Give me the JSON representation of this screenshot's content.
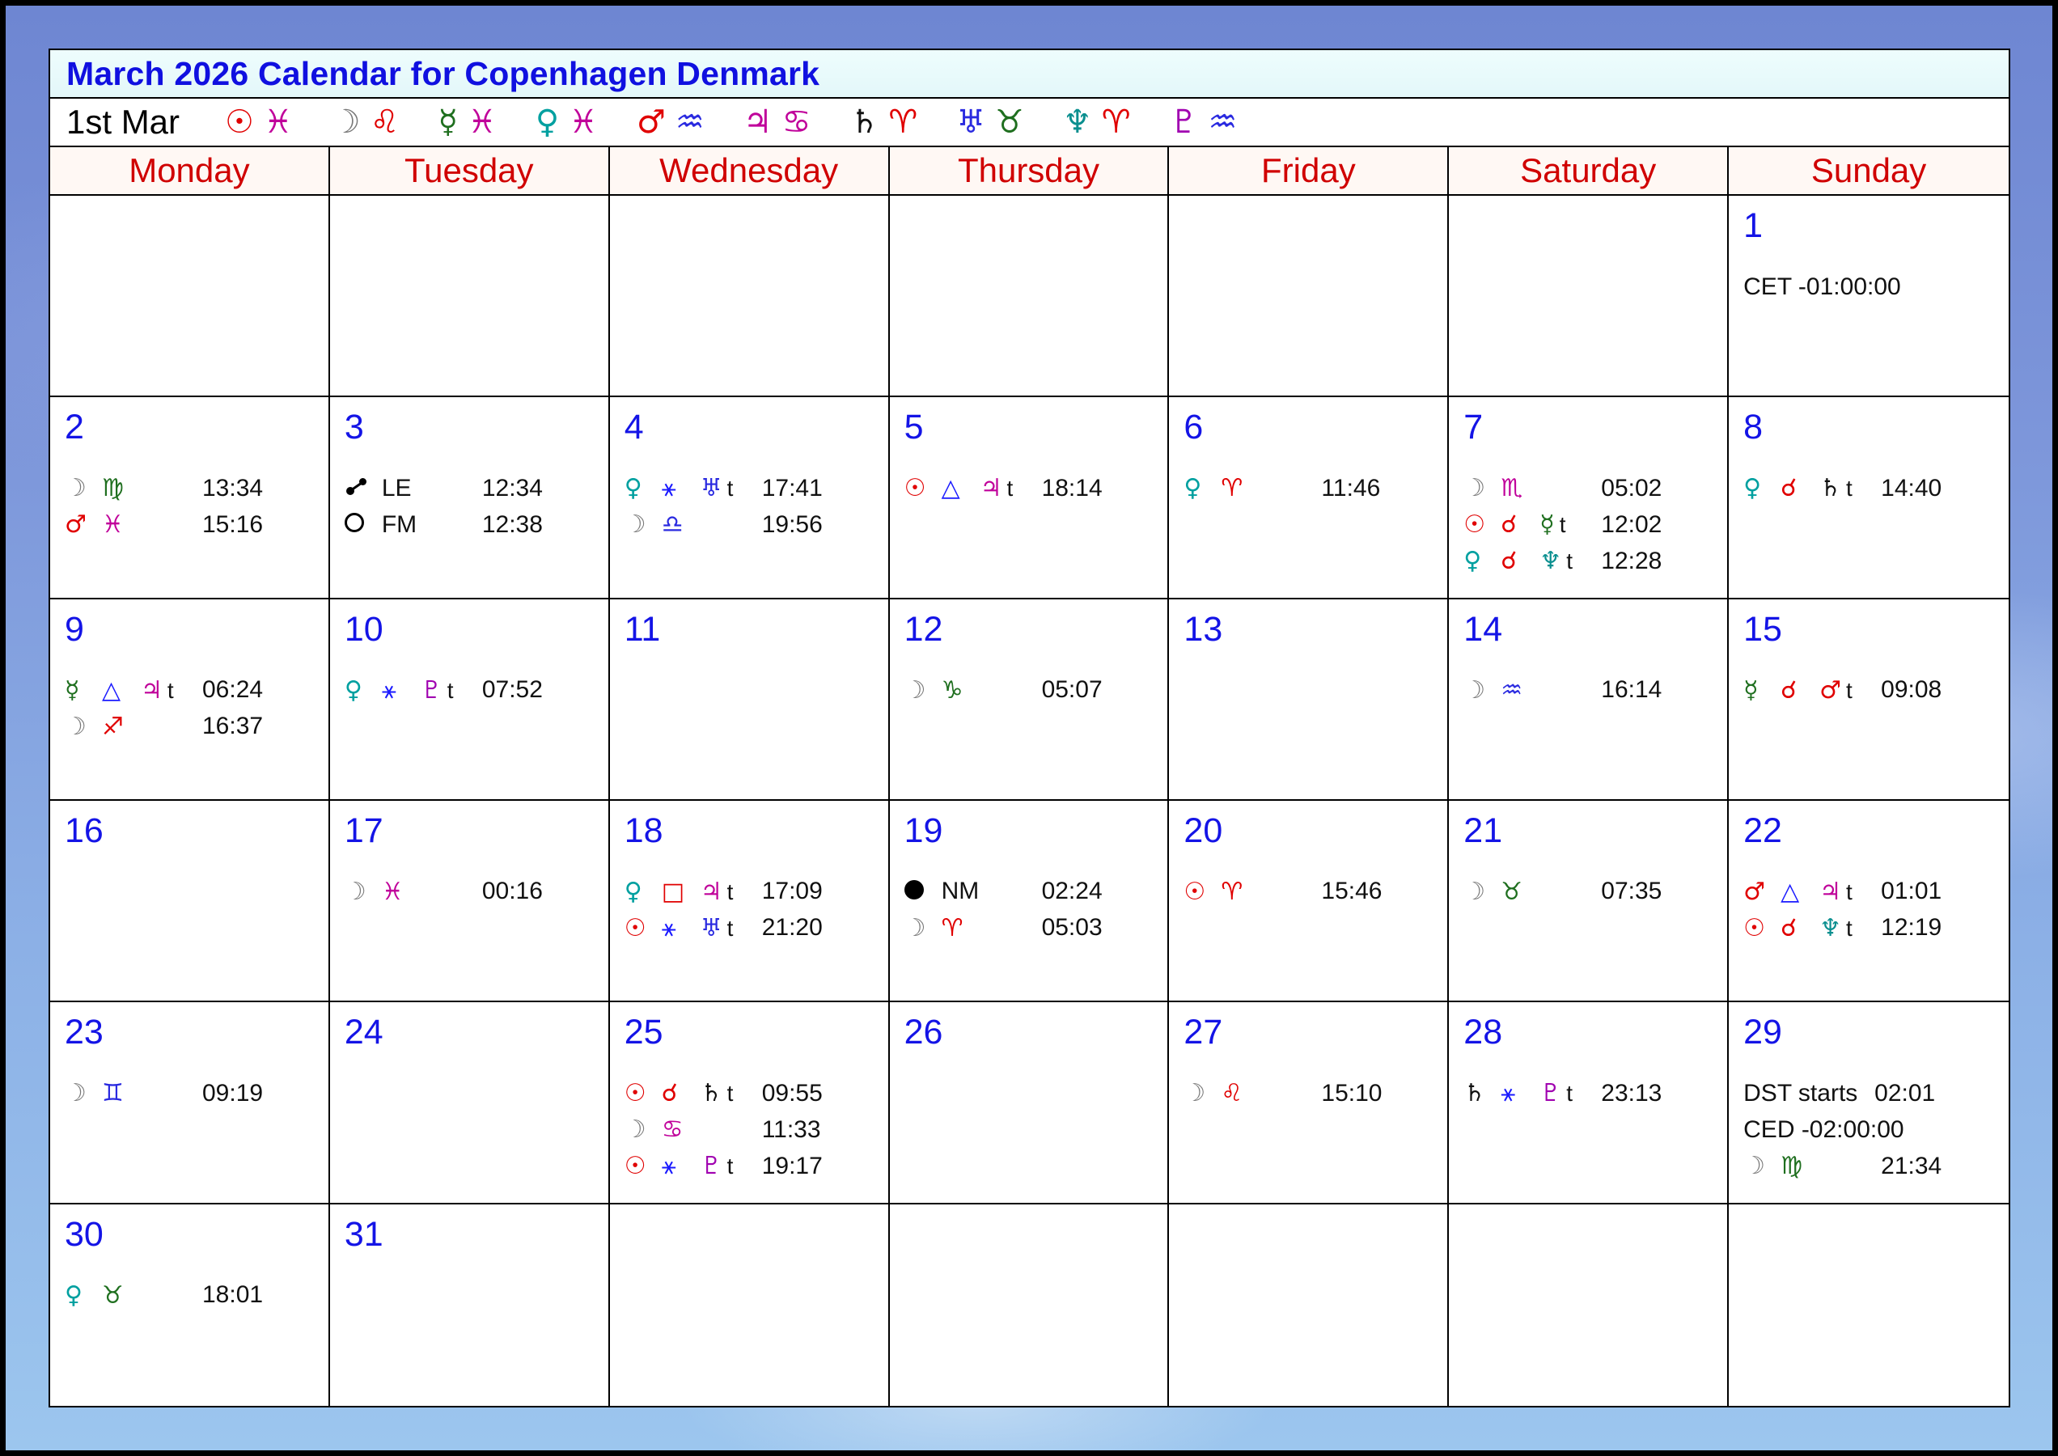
{
  "title": "March 2026 Calendar for Copenhagen Denmark",
  "positions": {
    "date": "1st Mar",
    "items": [
      {
        "p": "☉",
        "pc": "#e00000",
        "s": "♓",
        "sc": "#c0009a"
      },
      {
        "p": "☽",
        "pc": "#777777",
        "s": "♌",
        "sc": "#e00000"
      },
      {
        "p": "☿",
        "pc": "#1f6f1f",
        "s": "♓",
        "sc": "#c0009a"
      },
      {
        "p": "♀",
        "pc": "#00a0a0",
        "s": "♓",
        "sc": "#c0009a"
      },
      {
        "p": "♂",
        "pc": "#e00000",
        "s": "♒",
        "sc": "#2a2ae0"
      },
      {
        "p": "♃",
        "pc": "#c0009a",
        "s": "♋",
        "sc": "#c0009a"
      },
      {
        "p": "♄",
        "pc": "#111111",
        "s": "♈",
        "sc": "#e00000"
      },
      {
        "p": "♅",
        "pc": "#2a2ae0",
        "s": "♉",
        "sc": "#1f6f1f"
      },
      {
        "p": "♆",
        "pc": "#0a8f8f",
        "s": "♈",
        "sc": "#e00000"
      },
      {
        "p": "♇",
        "pc": "#a000b0",
        "s": "♒",
        "sc": "#2a2ae0"
      }
    ]
  },
  "weekdays": [
    "Monday",
    "Tuesday",
    "Wednesday",
    "Thursday",
    "Friday",
    "Saturday",
    "Sunday"
  ],
  "colors": {
    "sun": "#e00000",
    "moon": "#777777",
    "mercury": "#1f6f1f",
    "venus": "#00a0a0",
    "mars": "#e00000",
    "jupiter": "#c0009a",
    "saturn": "#111111",
    "uranus": "#2a2ae0",
    "neptune": "#0a8f8f",
    "pluto": "#a000b0",
    "aspect": "#1a1aff",
    "square": "#e00000",
    "opposition": "#e00000"
  },
  "days": {
    "1": [
      {
        "type": "text",
        "text": "CET -01:00:00"
      }
    ],
    "2": [
      {
        "a": "☽",
        "ac": "#777777",
        "b": "♍",
        "bc": "#1f6f1f",
        "time": "13:34"
      },
      {
        "a": "♂",
        "ac": "#e00000",
        "b": "♓",
        "bc": "#c0009a",
        "time": "15:16"
      }
    ],
    "3": [
      {
        "type": "label",
        "icon": "le",
        "label": "LE",
        "time": "12:34"
      },
      {
        "type": "label",
        "icon": "empty",
        "label": "FM",
        "time": "12:38"
      }
    ],
    "4": [
      {
        "a": "♀",
        "ac": "#00a0a0",
        "b": "⚹",
        "bc": "#1a1aff",
        "c": "♅",
        "cc": "#2a2ae0",
        "t": "t",
        "time": "17:41"
      },
      {
        "a": "☽",
        "ac": "#777777",
        "b": "♎",
        "bc": "#2a2ae0",
        "time": "19:56"
      }
    ],
    "5": [
      {
        "a": "☉",
        "ac": "#e00000",
        "b": "△",
        "bc": "#1a1aff",
        "c": "♃",
        "cc": "#c0009a",
        "t": "t",
        "time": "18:14"
      }
    ],
    "6": [
      {
        "a": "♀",
        "ac": "#00a0a0",
        "b": "♈",
        "bc": "#e00000",
        "time": "11:46"
      }
    ],
    "7": [
      {
        "a": "☽",
        "ac": "#777777",
        "b": "♏",
        "bc": "#c0009a",
        "time": "05:02"
      },
      {
        "a": "☉",
        "ac": "#e00000",
        "b": "☌",
        "bc": "#e00000",
        "c": "☿",
        "cc": "#1f6f1f",
        "t": "t",
        "time": "12:02"
      },
      {
        "a": "♀",
        "ac": "#00a0a0",
        "b": "☌",
        "bc": "#e00000",
        "c": "♆",
        "cc": "#0a8f8f",
        "t": "t",
        "time": "12:28"
      }
    ],
    "8": [
      {
        "a": "♀",
        "ac": "#00a0a0",
        "b": "☌",
        "bc": "#e00000",
        "c": "♄",
        "cc": "#111111",
        "t": "t",
        "time": "14:40"
      }
    ],
    "9": [
      {
        "a": "☿",
        "ac": "#1f6f1f",
        "b": "△",
        "bc": "#1a1aff",
        "c": "♃",
        "cc": "#c0009a",
        "t": "t",
        "time": "06:24"
      },
      {
        "a": "☽",
        "ac": "#777777",
        "b": "♐",
        "bc": "#e00000",
        "time": "16:37"
      }
    ],
    "10": [
      {
        "a": "♀",
        "ac": "#00a0a0",
        "b": "⚹",
        "bc": "#1a1aff",
        "c": "♇",
        "cc": "#a000b0",
        "t": "t",
        "time": "07:52"
      }
    ],
    "11": [],
    "12": [
      {
        "a": "☽",
        "ac": "#777777",
        "b": "♑",
        "bc": "#1f6f1f",
        "time": "05:07"
      }
    ],
    "13": [],
    "14": [
      {
        "a": "☽",
        "ac": "#777777",
        "b": "♒",
        "bc": "#2a2ae0",
        "time": "16:14"
      }
    ],
    "15": [
      {
        "a": "☿",
        "ac": "#1f6f1f",
        "b": "☌",
        "bc": "#e00000",
        "c": "♂",
        "cc": "#e00000",
        "t": "t",
        "time": "09:08"
      }
    ],
    "16": [],
    "17": [
      {
        "a": "☽",
        "ac": "#777777",
        "b": "♓",
        "bc": "#c0009a",
        "time": "00:16"
      }
    ],
    "18": [
      {
        "a": "♀",
        "ac": "#00a0a0",
        "b": "□",
        "bc": "#e00000",
        "c": "♃",
        "cc": "#c0009a",
        "t": "t",
        "time": "17:09"
      },
      {
        "a": "☉",
        "ac": "#e00000",
        "b": "⚹",
        "bc": "#1a1aff",
        "c": "♅",
        "cc": "#2a2ae0",
        "t": "t",
        "time": "21:20"
      }
    ],
    "19": [
      {
        "type": "label",
        "icon": "full",
        "label": "NM",
        "time": "02:24"
      },
      {
        "a": "☽",
        "ac": "#777777",
        "b": "♈",
        "bc": "#e00000",
        "time": "05:03"
      }
    ],
    "20": [
      {
        "a": "☉",
        "ac": "#e00000",
        "b": "♈",
        "bc": "#e00000",
        "time": "15:46"
      }
    ],
    "21": [
      {
        "a": "☽",
        "ac": "#777777",
        "b": "♉",
        "bc": "#1f6f1f",
        "time": "07:35"
      }
    ],
    "22": [
      {
        "a": "♂",
        "ac": "#e00000",
        "b": "△",
        "bc": "#1a1aff",
        "c": "♃",
        "cc": "#c0009a",
        "t": "t",
        "time": "01:01"
      },
      {
        "a": "☉",
        "ac": "#e00000",
        "b": "☌",
        "bc": "#e00000",
        "c": "♆",
        "cc": "#0a8f8f",
        "t": "t",
        "time": "12:19"
      }
    ],
    "23": [
      {
        "a": "☽",
        "ac": "#777777",
        "b": "♊",
        "bc": "#2a2ae0",
        "time": "09:19"
      }
    ],
    "24": [],
    "25": [
      {
        "a": "☉",
        "ac": "#e00000",
        "b": "☌",
        "bc": "#e00000",
        "c": "♄",
        "cc": "#111111",
        "t": "t",
        "time": "09:55"
      },
      {
        "a": "☽",
        "ac": "#777777",
        "b": "♋",
        "bc": "#c0009a",
        "time": "11:33"
      },
      {
        "a": "☉",
        "ac": "#e00000",
        "b": "⚹",
        "bc": "#1a1aff",
        "c": "♇",
        "cc": "#a000b0",
        "t": "t",
        "time": "19:17"
      }
    ],
    "26": [],
    "27": [
      {
        "a": "☽",
        "ac": "#777777",
        "b": "♌",
        "bc": "#e00000",
        "time": "15:10"
      }
    ],
    "28": [
      {
        "a": "♄",
        "ac": "#111111",
        "b": "⚹",
        "bc": "#1a1aff",
        "c": "♇",
        "cc": "#a000b0",
        "t": "t",
        "time": "23:13"
      }
    ],
    "29": [
      {
        "type": "textwide",
        "text": "DST starts",
        "time": "02:01"
      },
      {
        "type": "text",
        "text": "CED -02:00:00"
      },
      {
        "a": "☽",
        "ac": "#777777",
        "b": "♍",
        "bc": "#1f6f1f",
        "time": "21:34"
      }
    ],
    "30": [
      {
        "a": "♀",
        "ac": "#00a0a0",
        "b": "♉",
        "bc": "#1f6f1f",
        "time": "18:01"
      }
    ],
    "31": []
  }
}
